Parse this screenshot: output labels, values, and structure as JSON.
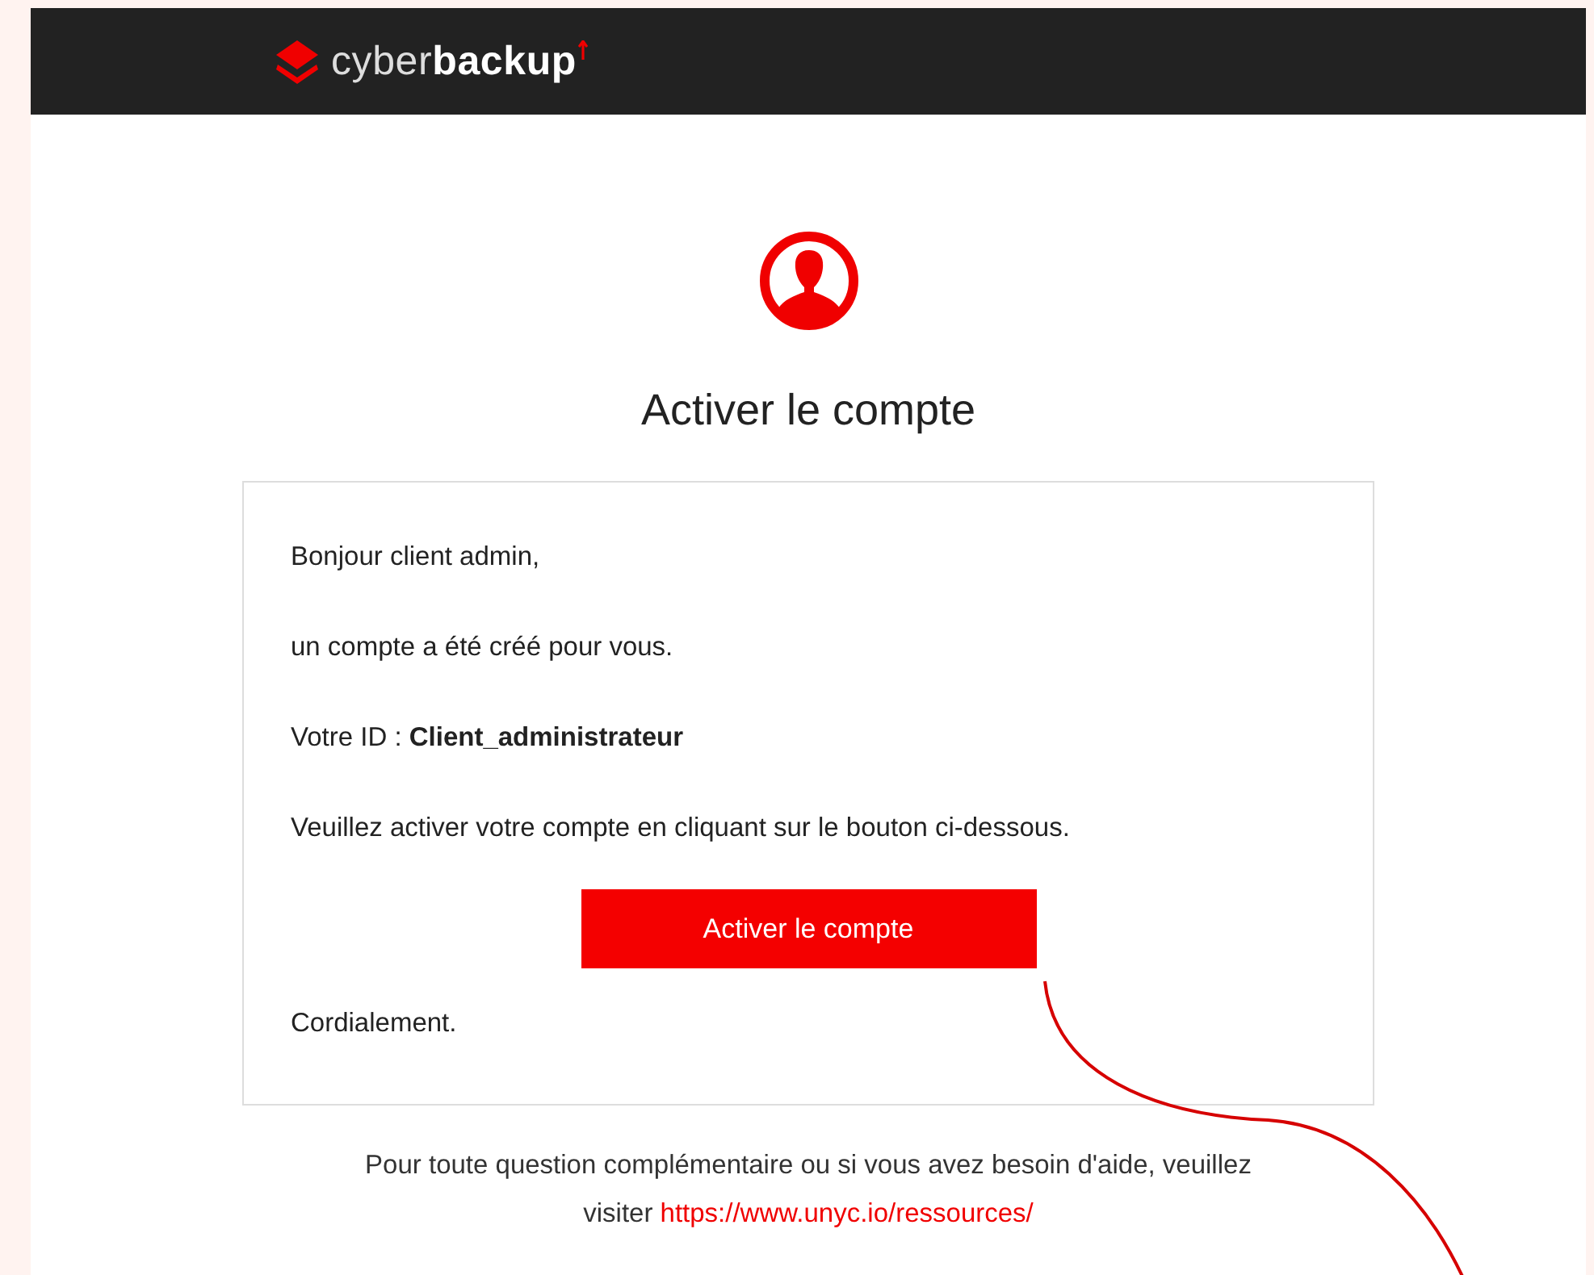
{
  "header": {
    "logo": {
      "light": "cyber",
      "bold": "backup"
    }
  },
  "title": "Activer le compte",
  "card": {
    "paragraphs": [
      "Bonjour client admin,",
      "un compte a été créé pour vous.",
      "Votre ID : **Client_administrateur**",
      "Veuillez activer votre compte en cliquant sur le bouton ci-dessous."
    ],
    "button": "Activer le compte",
    "closing": "Cordialement."
  },
  "footer": {
    "text": "Pour toute question complémentaire ou si vous avez besoin d'aide, veuillez visiter",
    "link": "https://www.unyc.io/ressources/"
  }
}
